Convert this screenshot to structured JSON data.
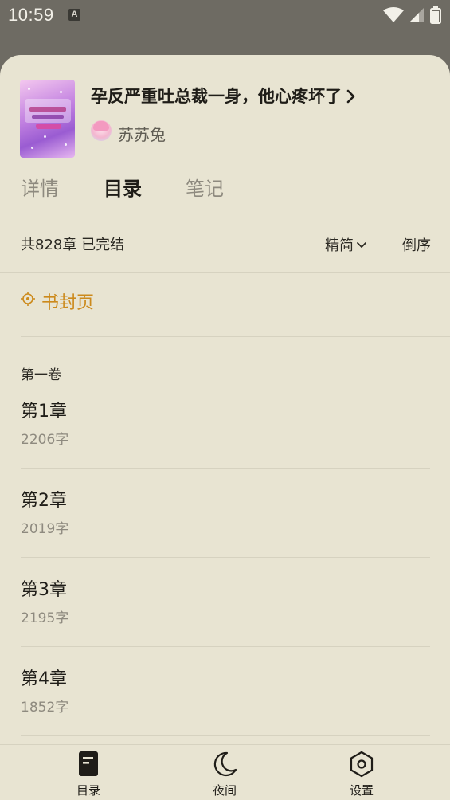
{
  "status_bar": {
    "time": "10:59",
    "notification_icon": "a-icon",
    "icons": [
      "wifi-icon",
      "signal-icon",
      "battery-icon"
    ]
  },
  "book": {
    "title": "孕反严重吐总裁一身，他心疼坏了",
    "author": "苏苏兔"
  },
  "tabs": [
    {
      "label": "详情",
      "active": false
    },
    {
      "label": "目录",
      "active": true
    },
    {
      "label": "笔记",
      "active": false
    }
  ],
  "catalog": {
    "summary": "共828章 已完结",
    "simplified_label": "精简",
    "reverse_label": "倒序",
    "cover_page_label": "书封页",
    "volume_title": "第一卷",
    "chapters": [
      {
        "title": "第1章",
        "words": "2206字"
      },
      {
        "title": "第2章",
        "words": "2019字"
      },
      {
        "title": "第3章",
        "words": "2195字"
      },
      {
        "title": "第4章",
        "words": "1852字"
      }
    ]
  },
  "bottom_nav": [
    {
      "label": "目录",
      "icon": "book-icon"
    },
    {
      "label": "夜间",
      "icon": "moon-icon"
    },
    {
      "label": "设置",
      "icon": "hexagon-settings-icon"
    }
  ],
  "colors": {
    "sheet_background": "#e8e4d2",
    "accent": "#cc8a1c",
    "text_primary": "#1f1d18",
    "text_secondary": "#8e8a7f",
    "overlay": "#6e6b63"
  }
}
